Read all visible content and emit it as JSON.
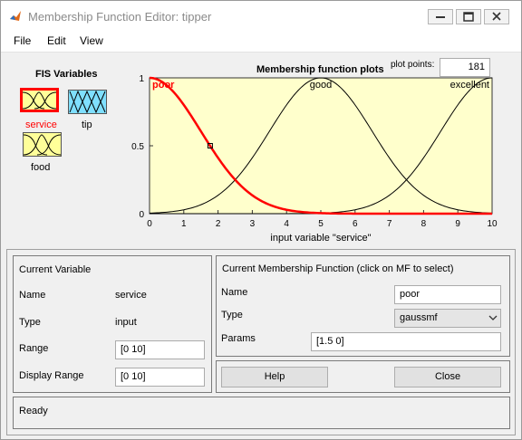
{
  "window": {
    "title": "Membership Function Editor: tipper",
    "controls": [
      "minimize-icon",
      "maximize-icon",
      "close-icon"
    ]
  },
  "menu": {
    "items": [
      "File",
      "Edit",
      "View"
    ]
  },
  "fis_variables": {
    "heading": "FIS Variables",
    "items": [
      {
        "name": "service",
        "role": "input",
        "selected": true,
        "color": "#ffff99",
        "label_color": "#ff0000"
      },
      {
        "name": "tip",
        "role": "output",
        "selected": false,
        "color": "#7fdfff",
        "label_color": "#000000"
      },
      {
        "name": "food",
        "role": "input",
        "selected": false,
        "color": "#ffff99",
        "label_color": "#000000"
      }
    ]
  },
  "plot": {
    "title": "Membership function plots",
    "plot_points_label": "plot points:",
    "plot_points_value": "181",
    "xlabel": "input variable \"service\"",
    "x_ticks": [
      "0",
      "1",
      "2",
      "3",
      "4",
      "5",
      "6",
      "7",
      "8",
      "9",
      "10"
    ],
    "y_ticks": [
      "0",
      "0.5",
      "1"
    ],
    "colors": {
      "background": "#ffffcc",
      "selected": "#ff0000",
      "normal": "#000000"
    }
  },
  "chart_data": {
    "type": "line",
    "title": "Membership function plots",
    "xlabel": "input variable \"service\"",
    "ylabel": "",
    "xlim": [
      0,
      10
    ],
    "ylim": [
      0,
      1
    ],
    "series": [
      {
        "name": "poor",
        "mf": "gaussmf",
        "sigma": 1.5,
        "center": 0,
        "selected": true
      },
      {
        "name": "good",
        "mf": "gaussmf",
        "sigma": 1.5,
        "center": 5,
        "selected": false
      },
      {
        "name": "excellent",
        "mf": "gaussmf",
        "sigma": 1.5,
        "center": 10,
        "selected": false
      }
    ],
    "marker": {
      "x": 1.77,
      "y": 0.5
    }
  },
  "current_variable": {
    "heading": "Current Variable",
    "name_label": "Name",
    "name_value": "service",
    "type_label": "Type",
    "type_value": "input",
    "range_label": "Range",
    "range_value": "[0 10]",
    "display_range_label": "Display Range",
    "display_range_value": "[0 10]"
  },
  "current_mf": {
    "heading": "Current Membership Function (click on MF to select)",
    "name_label": "Name",
    "name_value": "poor",
    "type_label": "Type",
    "type_value": "gaussmf",
    "params_label": "Params",
    "params_value": "[1.5 0]"
  },
  "buttons": {
    "help": "Help",
    "close": "Close"
  },
  "status": {
    "text": "Ready"
  }
}
